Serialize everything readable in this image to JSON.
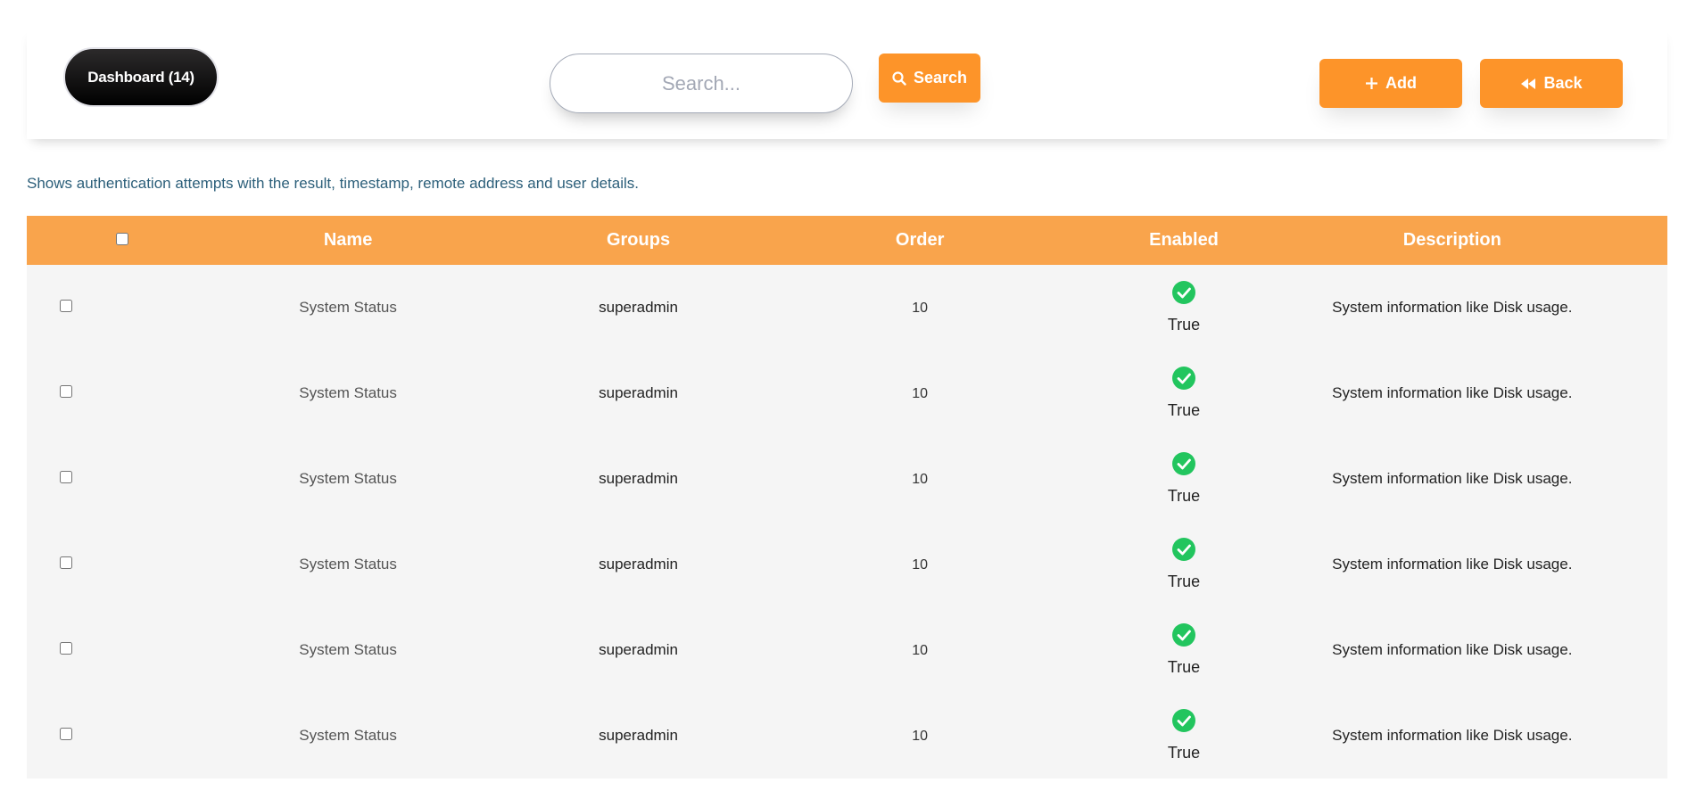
{
  "header": {
    "dashboard_label": "Dashboard (14)",
    "search_placeholder": "Search...",
    "search_value": "",
    "search_button_label": "Search",
    "add_button_label": "Add",
    "back_button_label": "Back"
  },
  "description": "Shows authentication attempts with the result, timestamp, remote address and user details.",
  "colors": {
    "accent": "#fd9429",
    "table_header": "#f9a44c",
    "enabled_check": "#22c55e",
    "row_background": "#f5f5f5"
  },
  "table": {
    "columns": [
      "Name",
      "Groups",
      "Order",
      "Enabled",
      "Description"
    ],
    "rows": [
      {
        "name": "System Status",
        "groups": "superadmin",
        "order": "10",
        "enabled": "True",
        "description": "System information like Disk usage."
      },
      {
        "name": "System Status",
        "groups": "superadmin",
        "order": "10",
        "enabled": "True",
        "description": "System information like Disk usage."
      },
      {
        "name": "System Status",
        "groups": "superadmin",
        "order": "10",
        "enabled": "True",
        "description": "System information like Disk usage."
      },
      {
        "name": "System Status",
        "groups": "superadmin",
        "order": "10",
        "enabled": "True",
        "description": "System information like Disk usage."
      },
      {
        "name": "System Status",
        "groups": "superadmin",
        "order": "10",
        "enabled": "True",
        "description": "System information like Disk usage."
      },
      {
        "name": "System Status",
        "groups": "superadmin",
        "order": "10",
        "enabled": "True",
        "description": "System information like Disk usage."
      }
    ]
  }
}
